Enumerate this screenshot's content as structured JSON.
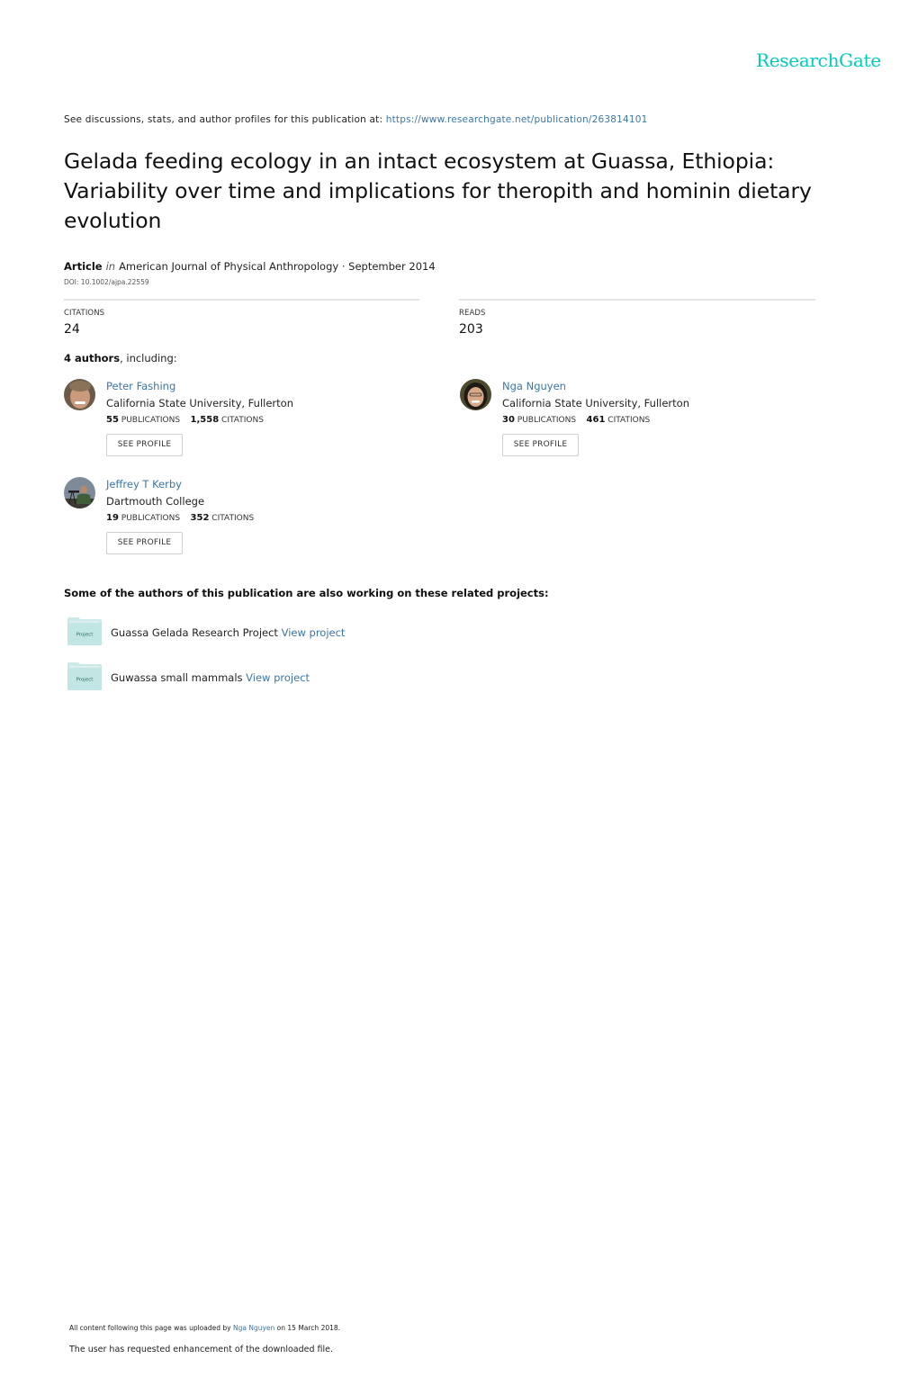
{
  "brand": {
    "logo": "ResearchGate",
    "accent": "#00ccbb",
    "link_color": "#3a77a8"
  },
  "header": {
    "intro_text": "See discussions, stats, and author profiles for this publication at: ",
    "publication_url": "https://www.researchgate.net/publication/263814101"
  },
  "publication": {
    "title": "Gelada feeding ecology in an intact ecosystem at Guassa, Ethiopia: Variability over time and implications for theropith and hominin dietary evolution",
    "type": "Article",
    "in_label": "in",
    "journal_date": "American Journal of Physical Anthropology · September 2014",
    "doi": "DOI: 10.1002/ajpa.22559"
  },
  "stats": {
    "citations_label": "CITATIONS",
    "citations_value": "24",
    "reads_label": "READS",
    "reads_value": "203"
  },
  "authors_section": {
    "count_bold": "4 authors",
    "suffix": ", including:",
    "authors": [
      {
        "name": "Peter Fashing",
        "institution": "California State University, Fullerton",
        "publications": "55",
        "publications_label": "PUBLICATIONS",
        "citations": "1,558",
        "citations_label": "CITATIONS",
        "button": "SEE PROFILE",
        "avatar_icon": "avatar-photo"
      },
      {
        "name": "Nga Nguyen",
        "institution": "California State University, Fullerton",
        "publications": "30",
        "publications_label": "PUBLICATIONS",
        "citations": "461",
        "citations_label": "CITATIONS",
        "button": "SEE PROFILE",
        "avatar_icon": "avatar-photo"
      },
      {
        "name": "Jeffrey T Kerby",
        "institution": "Dartmouth College",
        "publications": "19",
        "publications_label": "PUBLICATIONS",
        "citations": "352",
        "citations_label": "CITATIONS",
        "button": "SEE PROFILE",
        "avatar_icon": "avatar-photo"
      }
    ]
  },
  "projects_section": {
    "heading": "Some of the authors of this publication are also working on these related projects:",
    "projects": [
      {
        "icon_label": "Project",
        "name": "Guassa Gelada Research Project",
        "link": "View project"
      },
      {
        "icon_label": "Project",
        "name": "Guwassa small mammals",
        "link": "View project"
      }
    ]
  },
  "footer": {
    "uploaded_prefix": "All content following this page was uploaded by ",
    "uploader": "Nga Nguyen",
    "uploaded_suffix": " on 15 March 2018.",
    "note": "The user has requested enhancement of the downloaded file."
  }
}
